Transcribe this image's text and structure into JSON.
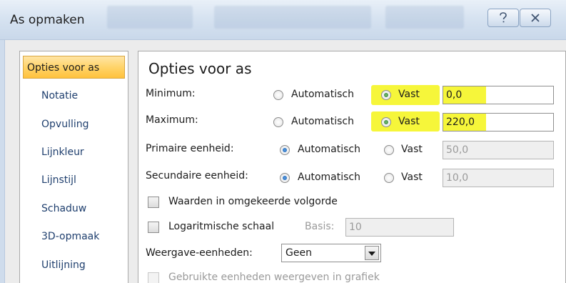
{
  "window": {
    "title": "As opmaken",
    "help_icon": "help-icon",
    "close_icon": "close-icon"
  },
  "nav": {
    "items": [
      {
        "label": "Opties voor as",
        "active": true
      },
      {
        "label": "Notatie",
        "active": false
      },
      {
        "label": "Opvulling",
        "active": false
      },
      {
        "label": "Lijnkleur",
        "active": false
      },
      {
        "label": "Lijnstijl",
        "active": false
      },
      {
        "label": "Schaduw",
        "active": false
      },
      {
        "label": "3D-opmaak",
        "active": false
      },
      {
        "label": "Uitlijning",
        "active": false
      }
    ]
  },
  "pane": {
    "heading": "Opties voor as",
    "rows": [
      {
        "label": "Minimum:",
        "auto_label": "Automatisch",
        "fixed_label": "Vast",
        "selected": "fixed",
        "value": "0,0",
        "highlighted": true
      },
      {
        "label": "Maximum:",
        "auto_label": "Automatisch",
        "fixed_label": "Vast",
        "selected": "fixed",
        "value": "220,0",
        "highlighted": true
      },
      {
        "label": "Primaire eenheid:",
        "auto_label": "Automatisch",
        "fixed_label": "Vast",
        "selected": "auto",
        "value": "50,0",
        "highlighted": false
      },
      {
        "label": "Secundaire eenheid:",
        "auto_label": "Automatisch",
        "fixed_label": "Vast",
        "selected": "auto",
        "value": "10,0",
        "highlighted": false
      }
    ],
    "reverse_order_label": "Waarden in omgekeerde volgorde",
    "log_scale_label": "Logaritmische schaal",
    "base_label": "Basis:",
    "base_value": "10",
    "display_units_label": "Weergave-eenheden:",
    "display_units_value": "Geen",
    "show_units_label": "Gebruikte eenheden weergeven in grafiek",
    "highlight_color": "#f6f63a"
  }
}
